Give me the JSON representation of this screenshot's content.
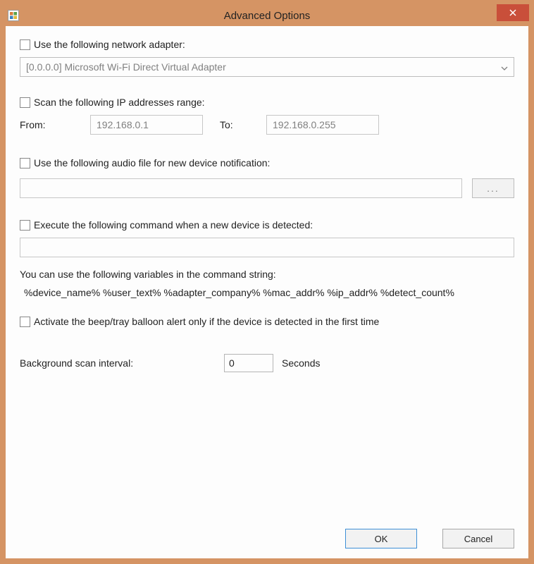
{
  "title": "Advanced Options",
  "adapter": {
    "chk_label": "Use the following network adapter:",
    "selected": "[0.0.0.0]  Microsoft Wi-Fi Direct Virtual Adapter"
  },
  "ip_range": {
    "chk_label": "Scan the following IP addresses range:",
    "from_label": "From:",
    "from_value": "192.168.0.1",
    "to_label": "To:",
    "to_value": "192.168.0.255"
  },
  "audio": {
    "chk_label": "Use the following audio file for new device notification:",
    "path": "",
    "browse_label": "..."
  },
  "command": {
    "chk_label": "Execute the following command when a new device is detected:",
    "value": "",
    "help": "You can use the following variables in the command string:",
    "vars": "%device_name%  %user_text%  %adapter_company%  %mac_addr%  %ip_addr%  %detect_count%"
  },
  "first_time": {
    "chk_label": "Activate the beep/tray balloon alert only if the device is detected in the first time"
  },
  "interval": {
    "label": "Background scan interval:",
    "value": "0",
    "unit": "Seconds"
  },
  "buttons": {
    "ok": "OK",
    "cancel": "Cancel"
  }
}
